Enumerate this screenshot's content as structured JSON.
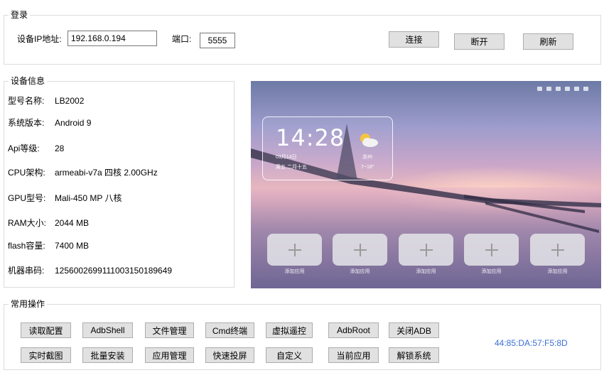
{
  "login": {
    "title": "登录",
    "ip_label": "设备IP地址:",
    "ip_value": "192.168.0.194",
    "port_label": "端口:",
    "port_value": "5555",
    "connect": "连接",
    "disconnect": "断开",
    "refresh": "刷新"
  },
  "device": {
    "title": "设备信息",
    "rows": [
      {
        "label": "型号名称:",
        "value": "LB2002"
      },
      {
        "label": "系统版本:",
        "value": "Android 9"
      },
      {
        "label": "Api等级:",
        "value": "28"
      },
      {
        "label": "CPU架构:",
        "value": "armeabi-v7a 四核 2.00GHz"
      },
      {
        "label": "GPU型号:",
        "value": "Mali-450 MP 八核"
      },
      {
        "label": "RAM大小:",
        "value": "2044 MB"
      },
      {
        "label": "flash容量:",
        "value": "7400 MB"
      },
      {
        "label": "机器串码:",
        "value": "12560026991110031501896​49"
      }
    ]
  },
  "screen": {
    "time": "14:28",
    "date": "03月14日",
    "lunar": "周五  二月十五",
    "city": "苏州",
    "temp": "7~18°",
    "weather_icon": "partly-cloudy-icon",
    "app_label": "添加应用"
  },
  "ops": {
    "title": "常用操作",
    "row1": [
      "读取配置",
      "AdbShell",
      "文件管理",
      "Cmd终端",
      "虚拟遥控",
      "AdbRoot",
      "关闭ADB"
    ],
    "row2": [
      "实时截图",
      "批量安装",
      "应用管理",
      "快速投屏",
      "自定义",
      "当前应用",
      "解锁系统"
    ],
    "mac": "44:85:DA:57:F5:8D"
  },
  "colors": {
    "mac_text": "#3b6fd6",
    "button_bg": "#e1e1e1",
    "group_border": "#dcdcdc"
  }
}
